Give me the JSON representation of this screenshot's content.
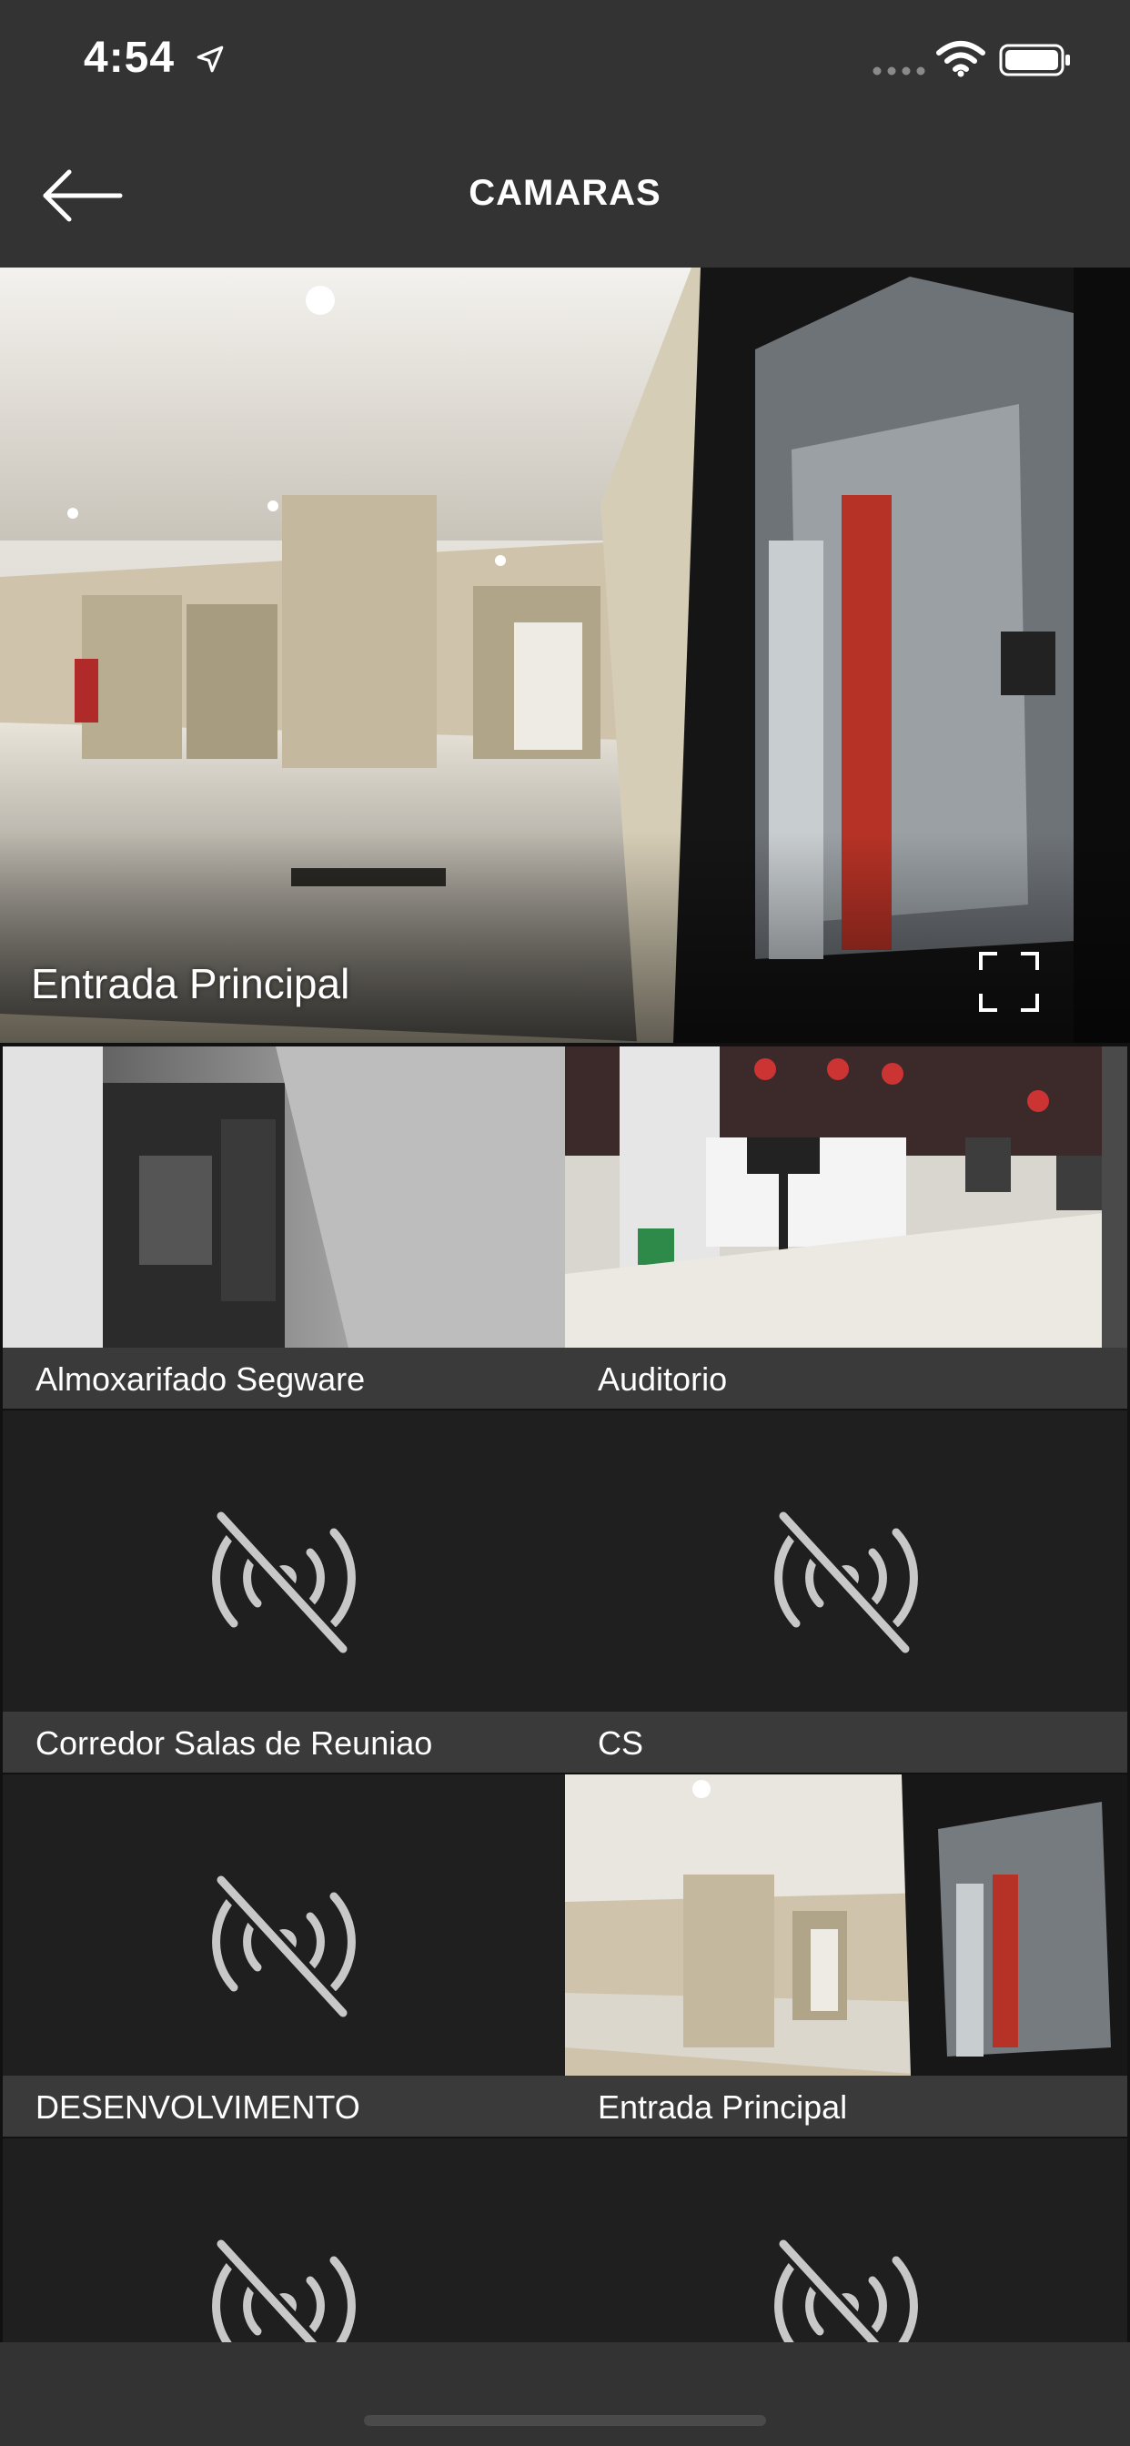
{
  "status_bar": {
    "time": "4:54",
    "location_icon": "location-arrow-icon",
    "signal_icon": "signal-dots-icon",
    "wifi_icon": "wifi-icon",
    "battery_icon": "battery-icon"
  },
  "nav": {
    "title": "CAMARAS",
    "back_icon": "back-arrow-icon"
  },
  "featured_camera": {
    "label": "Entrada Principal",
    "fullscreen_icon": "fullscreen-icon"
  },
  "cameras": [
    {
      "name": "Almoxarifado Segware",
      "status": "live"
    },
    {
      "name": "Auditorio",
      "status": "live"
    },
    {
      "name": "Corredor Salas de Reuniao",
      "status": "offline"
    },
    {
      "name": "CS",
      "status": "offline"
    },
    {
      "name": "DESENVOLVIMENTO",
      "status": "offline"
    },
    {
      "name": "Entrada Principal",
      "status": "live"
    },
    {
      "name": "",
      "status": "offline"
    },
    {
      "name": "",
      "status": "offline"
    }
  ],
  "offline_icon": "no-signal-icon",
  "colors": {
    "bar_background": "#333333",
    "tile_background": "#1f1f1f",
    "caption_background": "#3a3a3a",
    "icon_gray": "#c8c8c8"
  }
}
